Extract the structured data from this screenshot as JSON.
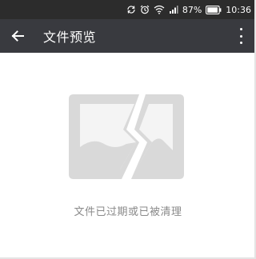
{
  "status_bar": {
    "battery_percent": "87%",
    "time": "10:36",
    "icons": [
      "sync-icon",
      "alarm-icon",
      "wifi-icon",
      "signal-icon",
      "battery-icon"
    ]
  },
  "app_bar": {
    "title": "文件预览",
    "back_icon": "arrow-left-icon",
    "more_icon": "more-vertical-icon"
  },
  "preview": {
    "placeholder_icon": "broken-image-icon",
    "message": "文件已过期或已被清理"
  },
  "colors": {
    "status_bar_bg": "#2c2c2c",
    "app_bar_bg": "#393a3f",
    "placeholder_gray": "#d9d9d9",
    "message_text": "#8a8a8a"
  }
}
